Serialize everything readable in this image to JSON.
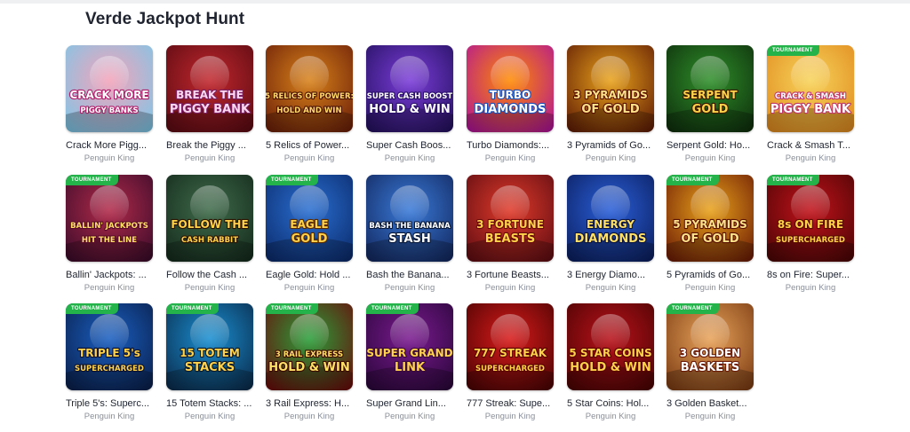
{
  "section": {
    "title": "Verde Jackpot Hunt"
  },
  "badge_label": "TOURNAMENT",
  "games": [
    {
      "title": "Crack More Pigg...",
      "provider": "Penguin King",
      "tournament": false,
      "art": [
        "CRACK MORE",
        "PIGGY BANKS"
      ],
      "bg1": "#f4a3b9",
      "bg2": "#7cc7e8",
      "textColor": "#ffffff",
      "stroke": "#b01e6a"
    },
    {
      "title": "Break the Piggy ...",
      "provider": "Penguin King",
      "tournament": false,
      "art": [
        "BREAK THE",
        "PIGGY BANK"
      ],
      "bg1": "#c1272d",
      "bg2": "#5a0a12",
      "textColor": "#ffd8f0",
      "stroke": "#7a1f63"
    },
    {
      "title": "5 Relics of Power...",
      "provider": "Penguin King",
      "tournament": false,
      "art": [
        "5 RELICS OF POWER:",
        "HOLD AND WIN"
      ],
      "bg1": "#d8821a",
      "bg2": "#6b1e08",
      "textColor": "#ffd86b",
      "stroke": "#4a1204"
    },
    {
      "title": "Super Cash Boos...",
      "provider": "Penguin King",
      "tournament": false,
      "art": [
        "SUPER CASH BOOST",
        "HOLD & WIN"
      ],
      "bg1": "#7a3cd8",
      "bg2": "#23105e",
      "textColor": "#ffffff",
      "stroke": "#2a0f6b"
    },
    {
      "title": "Turbo Diamonds:...",
      "provider": "Penguin King",
      "tournament": false,
      "art": [
        "TURBO",
        "DIAMONDS"
      ],
      "bg1": "#ff8a00",
      "bg2": "#b0129a",
      "textColor": "#ffffff",
      "stroke": "#1b4fb8"
    },
    {
      "title": "3 Pyramids of Go...",
      "provider": "Penguin King",
      "tournament": false,
      "art": [
        "3 PYRAMIDS",
        "OF GOLD"
      ],
      "bg1": "#e9a21a",
      "bg2": "#5e1a05",
      "textColor": "#ffe28a",
      "stroke": "#5a1203"
    },
    {
      "title": "Serpent Gold: Ho...",
      "provider": "Penguin King",
      "tournament": false,
      "art": [
        "SERPENT",
        "GOLD"
      ],
      "bg1": "#2f8f2a",
      "bg2": "#0e2e0c",
      "textColor": "#ffd24a",
      "stroke": "#3a1a00"
    },
    {
      "title": "Crack & Smash T...",
      "provider": "Penguin King",
      "tournament": true,
      "art": [
        "CRACK & SMASH",
        "PIGGY BANK"
      ],
      "bg1": "#f7d35a",
      "bg2": "#e08a1e",
      "textColor": "#ffffff",
      "stroke": "#c0396a"
    },
    {
      "title": "Ballin' Jackpots: ...",
      "provider": "Penguin King",
      "tournament": true,
      "art": [
        "BALLIN' JACKPOTS",
        "HIT THE LINE"
      ],
      "bg1": "#b12a4a",
      "bg2": "#3a0b2a",
      "textColor": "#ffe066",
      "stroke": "#5a0a2a"
    },
    {
      "title": "Follow the Cash ...",
      "provider": "Penguin King",
      "tournament": false,
      "art": [
        "FOLLOW THE",
        "CASH RABBIT"
      ],
      "bg1": "#3f6b4a",
      "bg2": "#142a1c",
      "textColor": "#ffd24a",
      "stroke": "#2a1404"
    },
    {
      "title": "Eagle Gold: Hold ...",
      "provider": "Penguin King",
      "tournament": true,
      "art": [
        "EAGLE",
        "GOLD"
      ],
      "bg1": "#2a6fd1",
      "bg2": "#0b2a6b",
      "textColor": "#ffd24a",
      "stroke": "#5a2a00"
    },
    {
      "title": "Bash the Banana...",
      "provider": "Penguin King",
      "tournament": false,
      "art": [
        "BASH THE BANANA",
        "STASH"
      ],
      "bg1": "#3a7ad8",
      "bg2": "#12275e",
      "textColor": "#ffffff",
      "stroke": "#0a1a3a"
    },
    {
      "title": "3 Fortune Beasts...",
      "provider": "Penguin King",
      "tournament": false,
      "art": [
        "3 FORTUNE",
        "BEASTS"
      ],
      "bg1": "#e03a2a",
      "bg2": "#5e0c12",
      "textColor": "#ffd24a",
      "stroke": "#6a0a0a"
    },
    {
      "title": "3 Energy Diamo...",
      "provider": "Penguin King",
      "tournament": false,
      "art": [
        "ENERGY",
        "DIAMONDS"
      ],
      "bg1": "#2a5fd8",
      "bg2": "#0b1e5e",
      "textColor": "#ffe066",
      "stroke": "#0a1440"
    },
    {
      "title": "5 Pyramids of Go...",
      "provider": "Penguin King",
      "tournament": true,
      "art": [
        "5 PYRAMIDS",
        "OF GOLD"
      ],
      "bg1": "#e9a21a",
      "bg2": "#6b1a05",
      "textColor": "#ffe28a",
      "stroke": "#5a1203"
    },
    {
      "title": "8s on Fire: Super...",
      "provider": "Penguin King",
      "tournament": true,
      "art": [
        "8s ON FIRE",
        "SUPERCHARGED"
      ],
      "bg1": "#c1121a",
      "bg2": "#4a0505",
      "textColor": "#ffd24a",
      "stroke": "#5a0a00"
    },
    {
      "title": "Triple 5's: Superc...",
      "provider": "Penguin King",
      "tournament": true,
      "art": [
        "TRIPLE 5's",
        "SUPERCHARGED"
      ],
      "bg1": "#1a5fc1",
      "bg2": "#0a1f4a",
      "textColor": "#ffd24a",
      "stroke": "#0a1030"
    },
    {
      "title": "15 Totem Stacks: ...",
      "provider": "Penguin King",
      "tournament": true,
      "art": [
        "15 TOTEM",
        "STACKS"
      ],
      "bg1": "#1a8fd1",
      "bg2": "#0a2a4a",
      "textColor": "#ffd24a",
      "stroke": "#0a1a2a"
    },
    {
      "title": "3 Rail Express: H...",
      "provider": "Penguin King",
      "tournament": true,
      "art": [
        "3 RAIL EXPRESS",
        "HOLD & WIN"
      ],
      "bg1": "#2a9f3a",
      "bg2": "#6b0a0a",
      "textColor": "#ffe066",
      "stroke": "#3a0a00"
    },
    {
      "title": "Super Grand Lin...",
      "provider": "Penguin King",
      "tournament": true,
      "art": [
        "SUPER GRAND",
        "LINK"
      ],
      "bg1": "#7a1a8f",
      "bg2": "#2a063a",
      "textColor": "#ffd24a",
      "stroke": "#3a0a3a"
    },
    {
      "title": "777 Streak: Supe...",
      "provider": "Penguin King",
      "tournament": false,
      "art": [
        "777 STREAK",
        "SUPERCHARGED"
      ],
      "bg1": "#d81a1a",
      "bg2": "#4a0303",
      "textColor": "#ffd24a",
      "stroke": "#5a0000"
    },
    {
      "title": "5 Star Coins: Hol...",
      "provider": "Penguin King",
      "tournament": false,
      "art": [
        "5 STAR COINS",
        "HOLD & WIN"
      ],
      "bg1": "#b8121a",
      "bg2": "#4a0303",
      "textColor": "#ffd24a",
      "stroke": "#5a0000"
    },
    {
      "title": "3 Golden Basket...",
      "provider": "Penguin King",
      "tournament": true,
      "art": [
        "3 GOLDEN",
        "BASKETS"
      ],
      "bg1": "#e8a35a",
      "bg2": "#7a3a12",
      "textColor": "#ffffff",
      "stroke": "#6a1a05"
    }
  ]
}
